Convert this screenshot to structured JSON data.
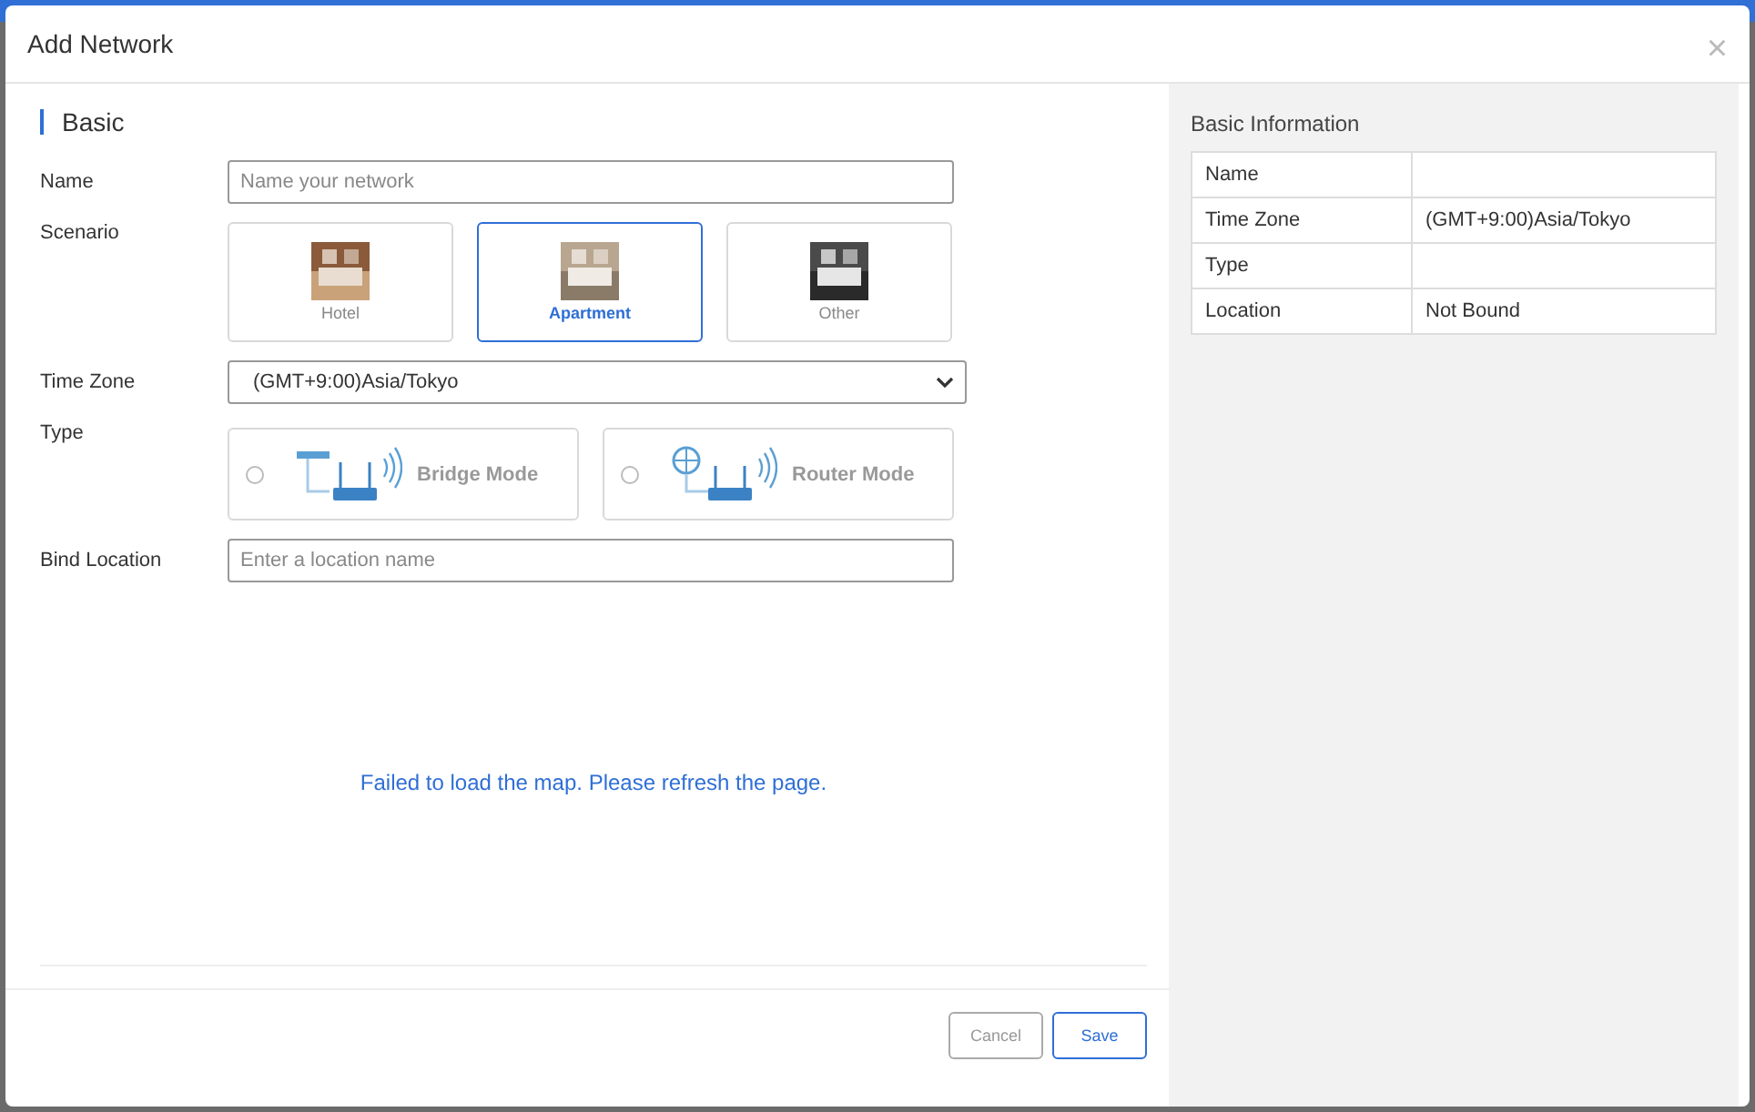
{
  "dialog": {
    "title": "Add Network",
    "close": "×"
  },
  "section": {
    "title": "Basic"
  },
  "form": {
    "name": {
      "label": "Name",
      "placeholder": "Name your network"
    },
    "scenario": {
      "label": "Scenario",
      "options": [
        {
          "label": "Hotel",
          "selected": false
        },
        {
          "label": "Apartment",
          "selected": true
        },
        {
          "label": "Other",
          "selected": false
        }
      ]
    },
    "time_zone": {
      "label": "Time Zone",
      "value": "(GMT+9:00)Asia/Tokyo"
    },
    "type": {
      "label": "Type",
      "options": [
        {
          "kind": "bridge",
          "label": "Bridge Mode",
          "selected": false
        },
        {
          "kind": "router",
          "label": "Router Mode",
          "selected": false
        }
      ]
    },
    "location": {
      "label": "Bind Location",
      "placeholder": "Enter a location name"
    }
  },
  "map": {
    "message": "Failed to load the map. Please refresh the page."
  },
  "buttons": {
    "cancel": "Cancel",
    "save": "Save"
  },
  "info": {
    "title": "Basic Information",
    "rows": [
      {
        "label": "Name"
      },
      {
        "label": "Time Zone",
        "value": "(GMT+9:00)Asia/Tokyo"
      },
      {
        "label": "Type"
      },
      {
        "label": "Location",
        "value": "Not Bound"
      }
    ]
  }
}
